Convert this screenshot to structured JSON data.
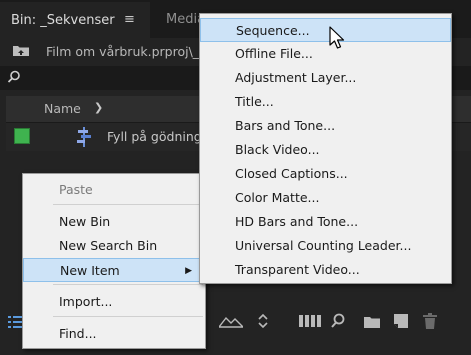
{
  "panel": {
    "active_tab": "Bin: _Sekvenser",
    "inactive_tab": "Media",
    "menu_icon": "hamburger-icon",
    "path": "Film om vårbruk.prproj\\_",
    "search_icon": "search-icon",
    "column_header": "Name",
    "items": [
      {
        "label": "Fyll på gödning",
        "color": "#3fb34f",
        "icon": "sequence-icon"
      }
    ]
  },
  "context_menu": {
    "items": [
      {
        "label": "Paste",
        "disabled": true
      },
      {
        "label": "New Bin",
        "disabled": false
      },
      {
        "label": "New Search Bin",
        "disabled": false
      },
      {
        "label": "New Item",
        "disabled": false,
        "highlighted": true,
        "submenu": true
      },
      {
        "label": "Import...",
        "disabled": false
      },
      {
        "label": "Find...",
        "disabled": false
      }
    ]
  },
  "submenu": {
    "items": [
      {
        "label": "Sequence...",
        "highlighted": true
      },
      {
        "label": "Offline File..."
      },
      {
        "label": "Adjustment Layer..."
      },
      {
        "label": "Title..."
      },
      {
        "label": "Bars and Tone..."
      },
      {
        "label": "Black Video..."
      },
      {
        "label": "Closed Captions..."
      },
      {
        "label": "Color Matte..."
      },
      {
        "label": "HD Bars and Tone..."
      },
      {
        "label": "Universal Counting Leader..."
      },
      {
        "label": "Transparent Video..."
      }
    ]
  },
  "toolbar_icons": [
    "list-view-icon",
    "zoom-slider-icon",
    "sort-icon",
    "automate-icon",
    "find-icon",
    "new-bin-icon",
    "new-item-icon",
    "clear-icon"
  ],
  "colors": {
    "panel_bg": "#232323",
    "menu_bg": "#f0f0f0",
    "menu_highlight": "#cde3f7",
    "label_green": "#3fb34f"
  }
}
